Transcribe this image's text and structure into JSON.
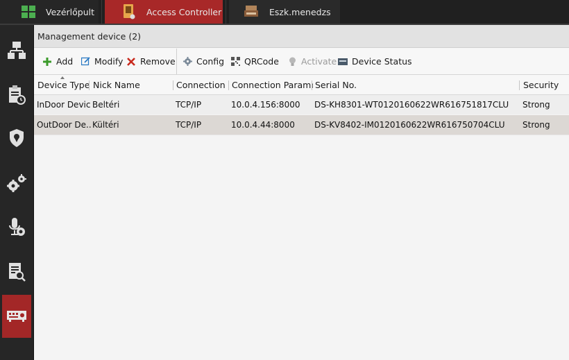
{
  "top_tabs": [
    {
      "label": "Vezérlőpult",
      "icon": "dashboard-grid-icon"
    },
    {
      "label": "Access Controller",
      "icon": "access-controller-icon"
    },
    {
      "label": "Eszk.menedzs",
      "icon": "device-management-icon"
    }
  ],
  "sidebar": {
    "items": [
      {
        "icon": "network-topology-icon"
      },
      {
        "icon": "clipboard-clock-icon"
      },
      {
        "icon": "shield-location-icon"
      },
      {
        "icon": "gears-icon"
      },
      {
        "icon": "microphone-camera-icon"
      },
      {
        "icon": "document-search-icon"
      },
      {
        "icon": "device-panel-icon",
        "active": true
      }
    ]
  },
  "main": {
    "header_title": "Management device (2)",
    "toolbar": {
      "add": "Add",
      "modify": "Modify",
      "remove": "Remove",
      "config": "Config",
      "qrcode": "QRCode",
      "activate": "Activate",
      "device_status": "Device Status"
    },
    "table": {
      "columns": [
        "Device Type",
        "Nick Name",
        "Connection ...",
        "Connection Parame...",
        "Serial No.",
        "Security"
      ],
      "rows": [
        [
          "InDoor Device",
          "Beltéri",
          "TCP/IP",
          "10.0.4.156:8000",
          "DS-KH8301-WT0120160622WR616751817CLU",
          "Strong"
        ],
        [
          "OutDoor De...",
          "Kültéri",
          "TCP/IP",
          "10.0.4.44:8000",
          "DS-KV8402-IM0120160622WR616750704CLU",
          "Strong"
        ]
      ]
    }
  },
  "colors": {
    "accent_red": "#a82828",
    "add_green": "#3a9a2a",
    "remove_red": "#c82a1e",
    "modify_blue": "#2b7ac4"
  }
}
